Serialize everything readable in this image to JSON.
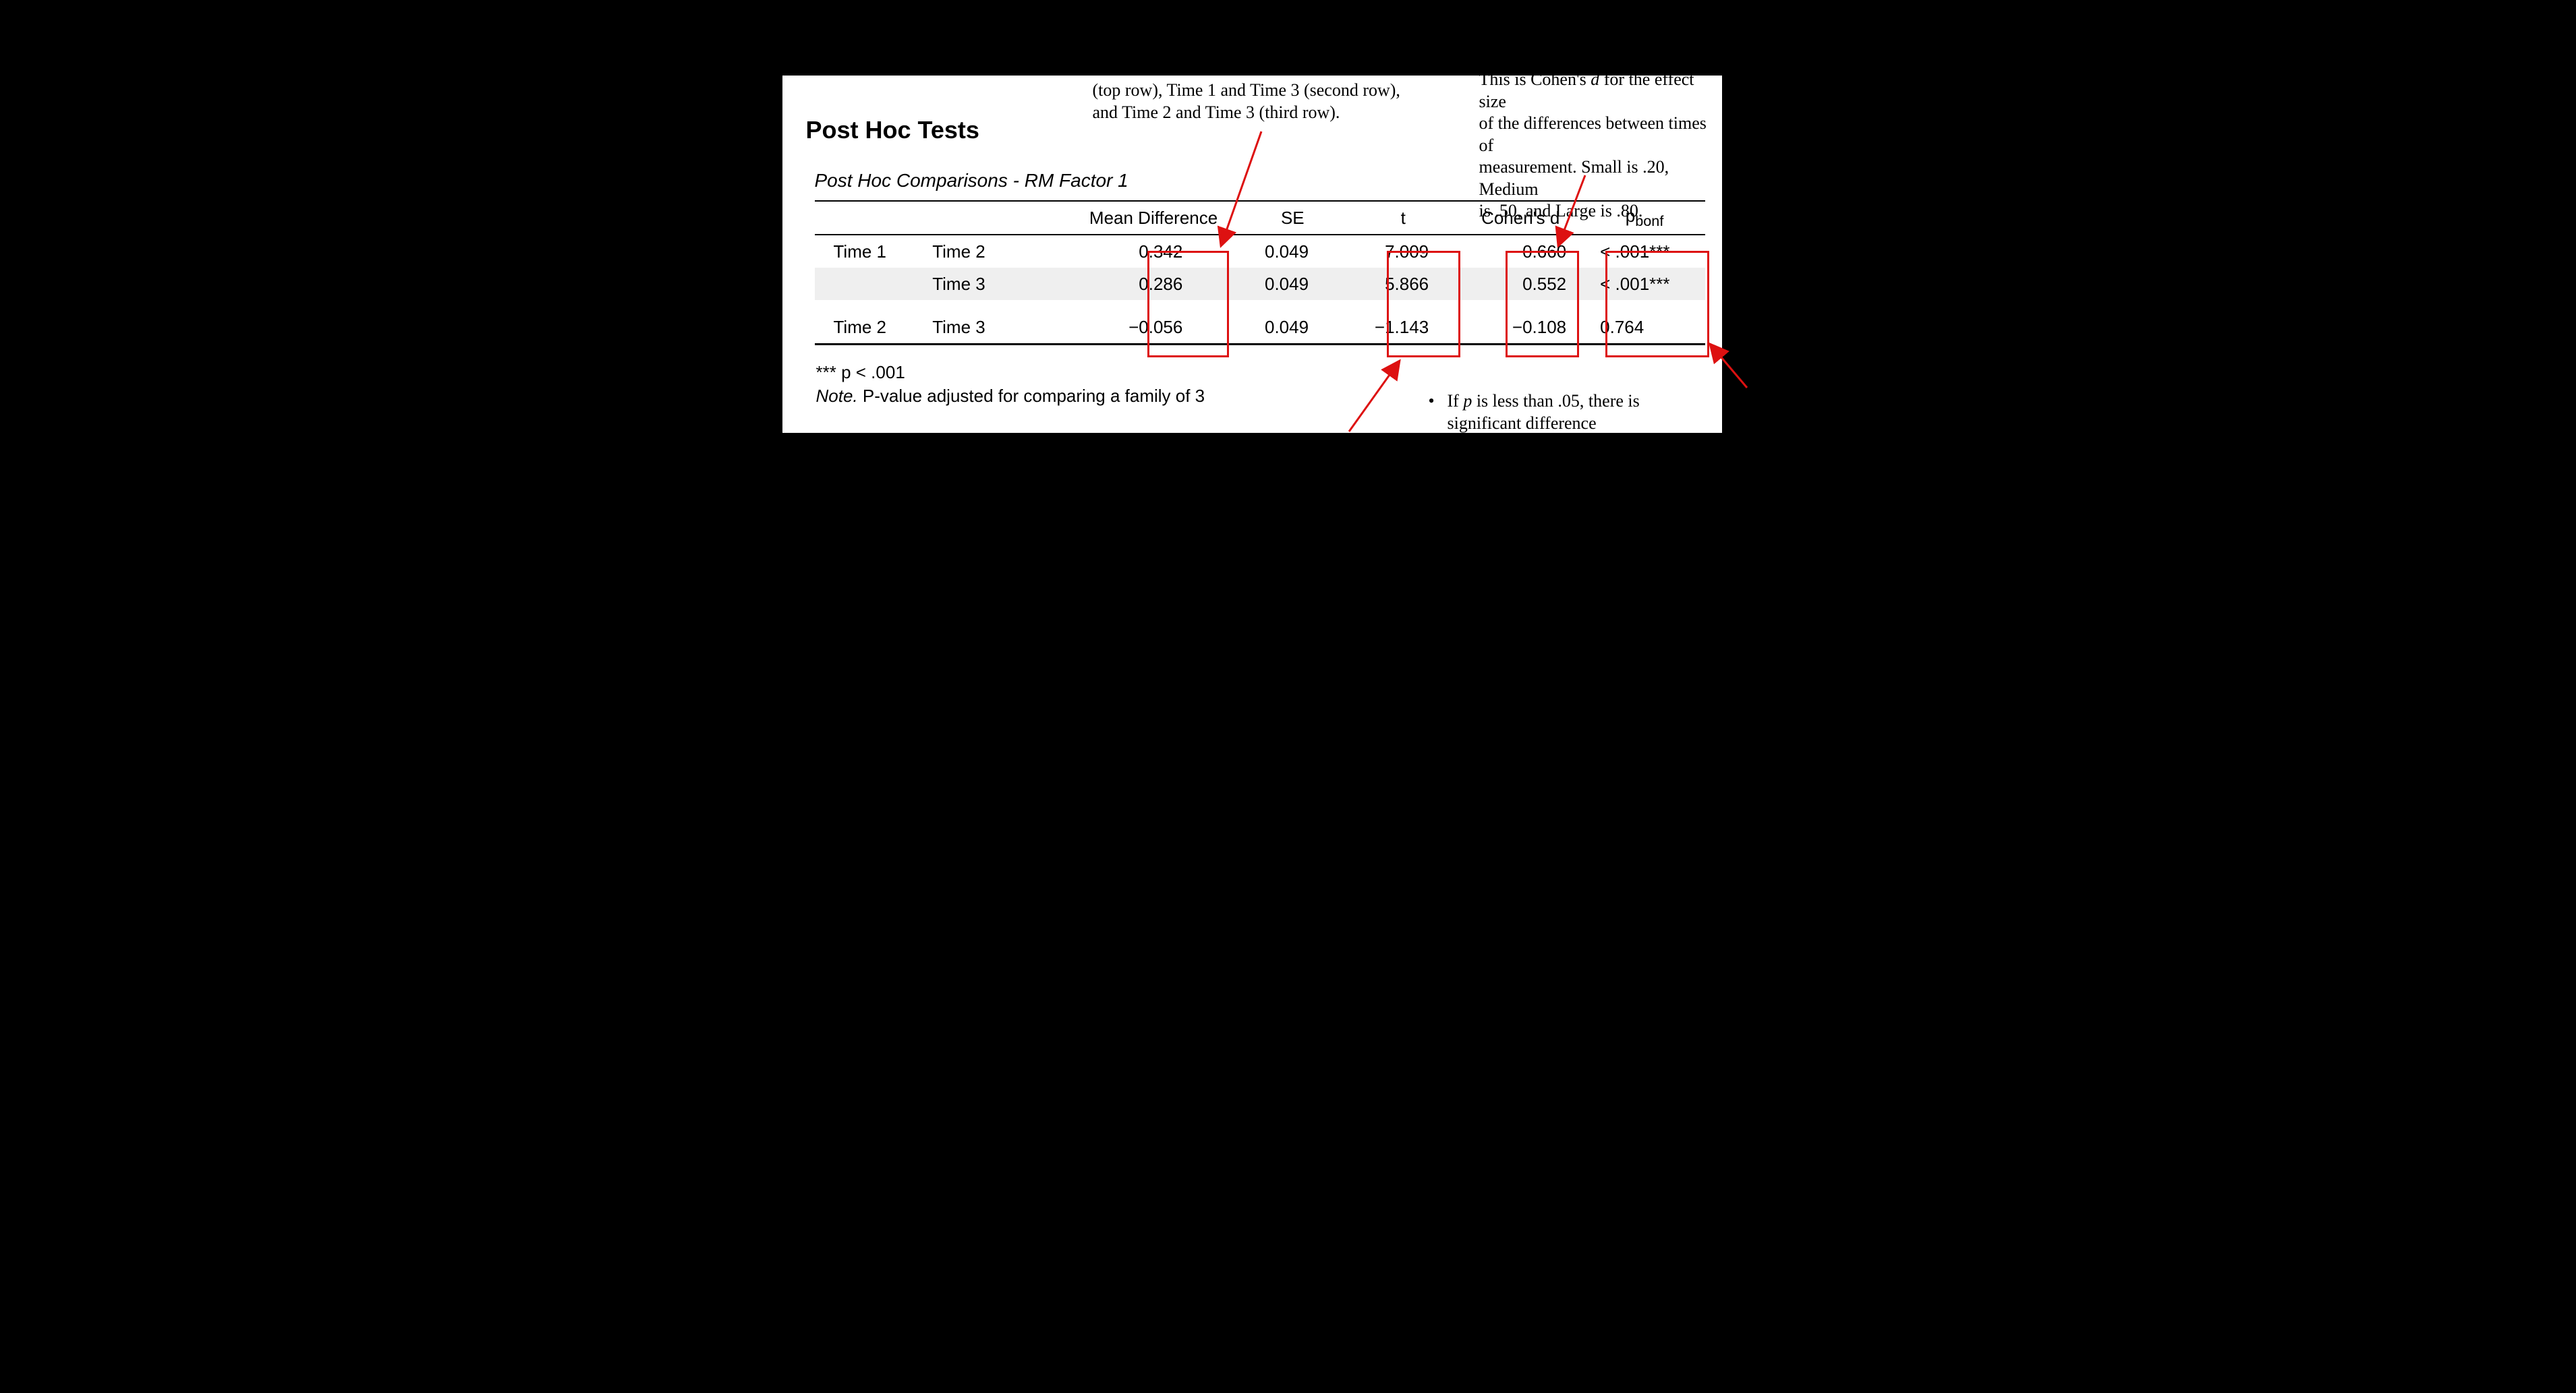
{
  "title": "Post Hoc Tests",
  "subtitle": "Post Hoc Comparisons - RM Factor 1",
  "headers": {
    "mean_diff": "Mean Difference",
    "se": "SE",
    "t": "t",
    "cohens_d": "Cohen's d",
    "pbonf_prefix": "p",
    "pbonf_suffix": "bonf"
  },
  "rows": [
    {
      "g1": "Time 1",
      "g2": "Time 2",
      "md": "0.342",
      "se": "0.049",
      "t": "7.009",
      "d": "0.660",
      "p": "< .001***"
    },
    {
      "g1": "",
      "g2": "Time 3",
      "md": "0.286",
      "se": "0.049",
      "t": "5.866",
      "d": "0.552",
      "p": "< .001***"
    },
    {
      "g1": "Time 2",
      "g2": "Time 3",
      "md": "−0.056",
      "se": "0.049",
      "t": "−1.143",
      "d": "−0.108",
      "p": "0.764"
    }
  ],
  "footnotes": {
    "sig": "*** p < .001",
    "note_label": "Note.",
    "note_text": " P-value adjusted for comparing a family of 3"
  },
  "annotations": {
    "top_left_l1": "(top row), Time 1 and Time 3 (second row),",
    "top_left_l2": "and Time 2 and Time 3 (third row).",
    "top_right_l1": "This is Cohen's ",
    "top_right_l1_ital": "d",
    "top_right_l1_tail": " for the effect size",
    "top_right_l2": "of the differences between times of",
    "top_right_l3": "measurement. Small is .20, Medium",
    "top_right_l4": "is .50, and Large is .80.",
    "bottom_right_l1a": "If ",
    "bottom_right_l1_ital": "p",
    "bottom_right_l1b": " is less than .05, there is",
    "bottom_right_l2": "significant difference"
  },
  "colors": {
    "annotation_red": "#d11"
  }
}
